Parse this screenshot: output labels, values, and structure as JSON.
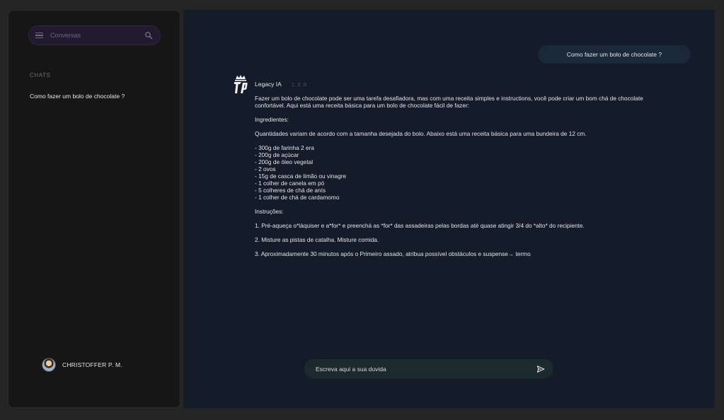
{
  "sidebar": {
    "search_placeholder": "Conversas",
    "chats_label": "CHATS",
    "chats": [
      {
        "title": "Como fazer um bolo de chocolate ?"
      }
    ],
    "user": {
      "name": "CHRISTOFFER P. M."
    }
  },
  "conversation": {
    "user_message": "Como fazer um bolo de chocolate ?",
    "bot": {
      "name": "Legacy IA",
      "time": "1.3 S",
      "intro": "Fazer um bolo de chocolate pode ser uma tarefa desafiadora, mas com uma receita simples e instructions, você pode criar um bom chá de chocolate confortável. Aqui está uma receita básica para um bolo de chocolate fácil de fazer:",
      "ingredients_title": "Ingredientes:",
      "quantities_note": "Quantidades variam de acordo com a tamanha desejada do bolo. Abaixo está uma receita básica para uma bundeira de 12 cm.",
      "ingredients": [
        "- 300g de farinha 2 era",
        "- 200g de açúcar",
        "- 200g de óleo vegetal",
        "- 2 ovos",
        "- 15g de casca de limão ou vinagre",
        "- 1 colher de canela em pó",
        "- 5 colheres de chá de anís",
        "- 1 colher de chá de cardamomo"
      ],
      "instructions_title": "Instruções:",
      "steps": [
        "1. Pré-aqueça o*láquiser e a*for* e preenchá as *for* das assadeiras pelas bordas até quase atingir 3/4 do *alto* do recipiente.",
        "2. Misture as pistas de catalha. Misture comida.",
        "3. Aproximadamente 30 minutos após o Primeiro assado, atribua possível obstáculos e suspense→ termo"
      ]
    }
  },
  "composer": {
    "placeholder": "Escreva aqui a sua duvida"
  },
  "icons": {
    "menu": "menu-icon",
    "search": "search-icon",
    "send": "send-icon",
    "logo": "legacy-crown-logo"
  },
  "colors": {
    "background": "#252525",
    "sidebar_bg": "#161616",
    "main_bg": "#151c29",
    "search_bg": "#221b30",
    "user_bubble_bg": "#1b2838",
    "composer_bg": "#1c2a2e"
  }
}
